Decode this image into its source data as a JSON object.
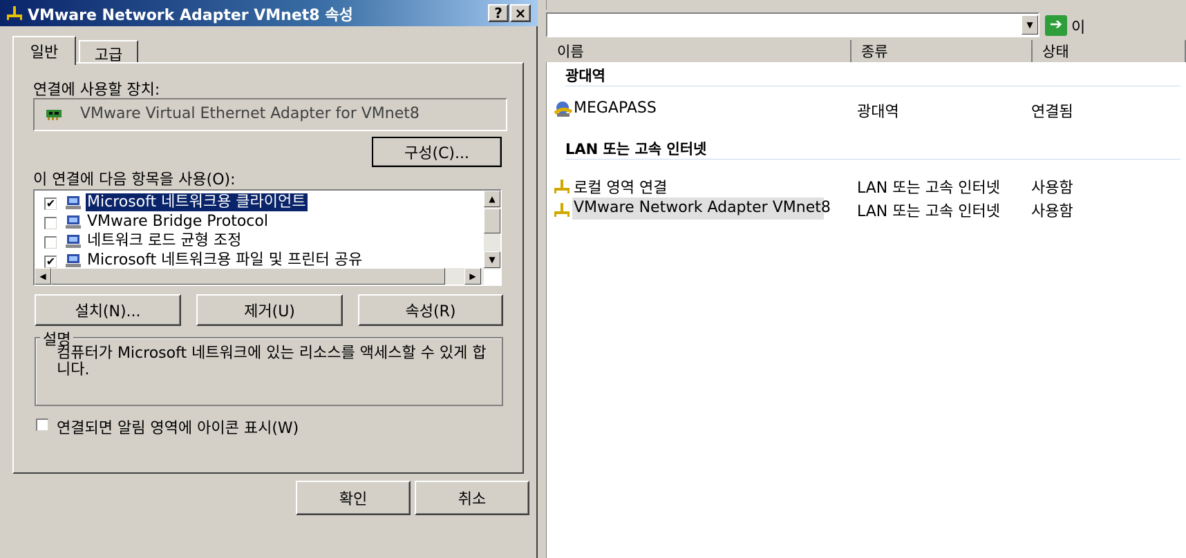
{
  "dialog": {
    "title": "VMware Network Adapter VMnet8 속성",
    "help_label": "?",
    "close_label": "×",
    "tabs": [
      {
        "label": "일반"
      },
      {
        "label": "고급"
      }
    ],
    "connect_using_label": "연결에 사용할 장치:",
    "adapter_name": "VMware Virtual Ethernet Adapter for VMnet8",
    "configure_button": "구성(C)...",
    "items_label": "이 연결에 다음 항목을 사용(O):",
    "components": [
      {
        "label": "Microsoft 네트워크용 클라이언트",
        "checked": true,
        "selected": true
      },
      {
        "label": "VMware Bridge Protocol",
        "checked": false,
        "selected": false
      },
      {
        "label": "네트워크 로드 균형 조정",
        "checked": false,
        "selected": false
      },
      {
        "label": "Microsoft 네트워크용 파일 및 프린터 공유",
        "checked": true,
        "selected": false
      }
    ],
    "install_button": "설치(N)...",
    "uninstall_button": "제거(U)",
    "properties_button": "속성(R)",
    "description_title": "설명",
    "description_text": "컴퓨터가 Microsoft 네트워크에 있는 리소스를 액세스할 수 있게 합니다.",
    "show_icon_label": "연결되면 알림 영역에 아이콘 표시(W)",
    "show_icon_checked": false,
    "ok_button": "확인",
    "cancel_button": "취소"
  },
  "explorer": {
    "address_value": "",
    "go_label": "이",
    "columns": [
      "이름",
      "종류",
      "상태"
    ],
    "groups": [
      {
        "title": "광대역",
        "items": [
          {
            "name": "MEGAPASS",
            "type": "광대역",
            "status": "연결됨",
            "icon": "broadband-icon"
          }
        ]
      },
      {
        "title": "LAN 또는 고속 인터넷",
        "items": [
          {
            "name": "로컬 영역 연결",
            "type": "LAN 또는 고속 인터넷",
            "status": "사용함",
            "icon": "network-connection-icon"
          },
          {
            "name": "VMware Network Adapter VMnet8",
            "type": "LAN 또는 고속 인터넷",
            "status": "사용함",
            "icon": "network-connection-icon",
            "selected": true
          }
        ]
      }
    ]
  },
  "colors": {
    "title_start": "#0a246a",
    "title_end": "#a6caf0",
    "selection": "#0a246a",
    "face": "#d4d0c8"
  }
}
